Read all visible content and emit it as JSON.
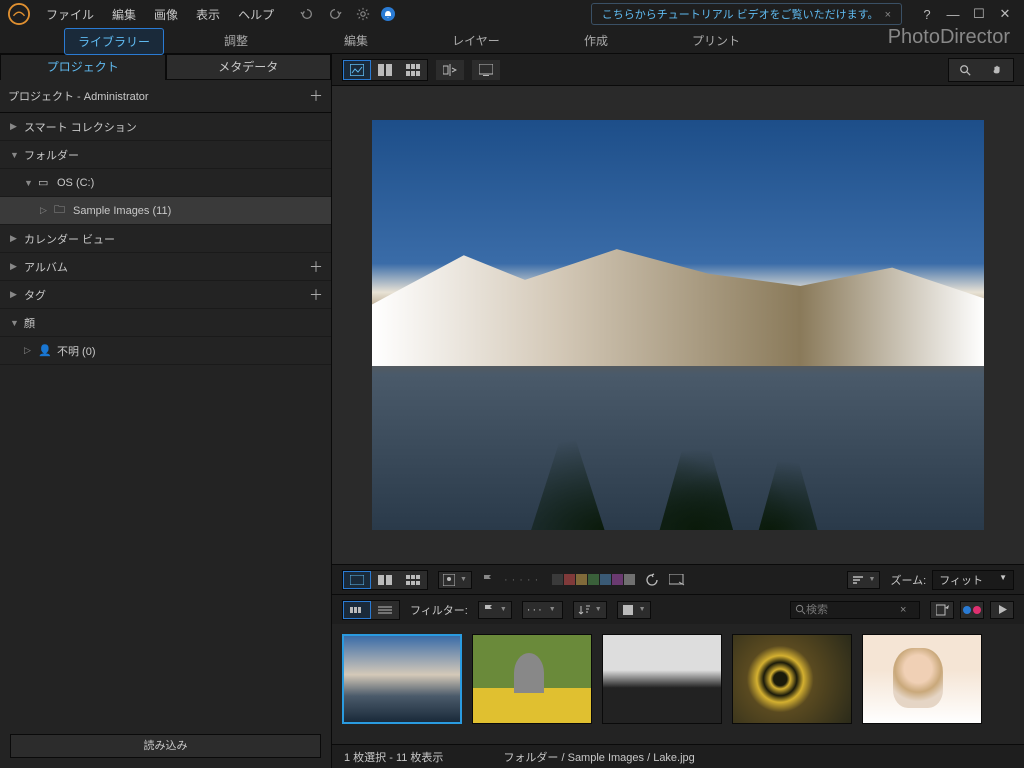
{
  "menu": {
    "file": "ファイル",
    "edit": "編集",
    "image": "画像",
    "view": "表示",
    "help": "ヘルプ"
  },
  "tutorial": {
    "text": "こちらからチュートリアル ビデオをご覧いただけます。"
  },
  "brand": "PhotoDirector",
  "modes": {
    "library": "ライブラリー",
    "adjust": "調整",
    "edit": "編集",
    "layer": "レイヤー",
    "create": "作成",
    "print": "プリント"
  },
  "sidetabs": {
    "project": "プロジェクト",
    "metadata": "メタデータ"
  },
  "project": {
    "label": "プロジェクト - Administrator"
  },
  "tree": {
    "smart": "スマート コレクション",
    "folder": "フォルダー",
    "drive": "OS (C:)",
    "sample": "Sample Images (11)",
    "calendar": "カレンダー ビュー",
    "album": "アルバム",
    "tag": "タグ",
    "face": "顔",
    "unknown": "不明 (0)"
  },
  "importbtn": "読み込み",
  "zoom": {
    "label": "ズーム:",
    "value": "フィット"
  },
  "filter": {
    "label": "フィルター:"
  },
  "search": {
    "placeholder": "検索"
  },
  "swatches": [
    "#3a3a3a",
    "#803a3a",
    "#806a3a",
    "#3a603a",
    "#3a5a75",
    "#6a3a70",
    "#707070"
  ],
  "status": {
    "selection": "1 枚選択 - 11 枚表示",
    "path": "フォルダー / Sample Images / Lake.jpg"
  }
}
